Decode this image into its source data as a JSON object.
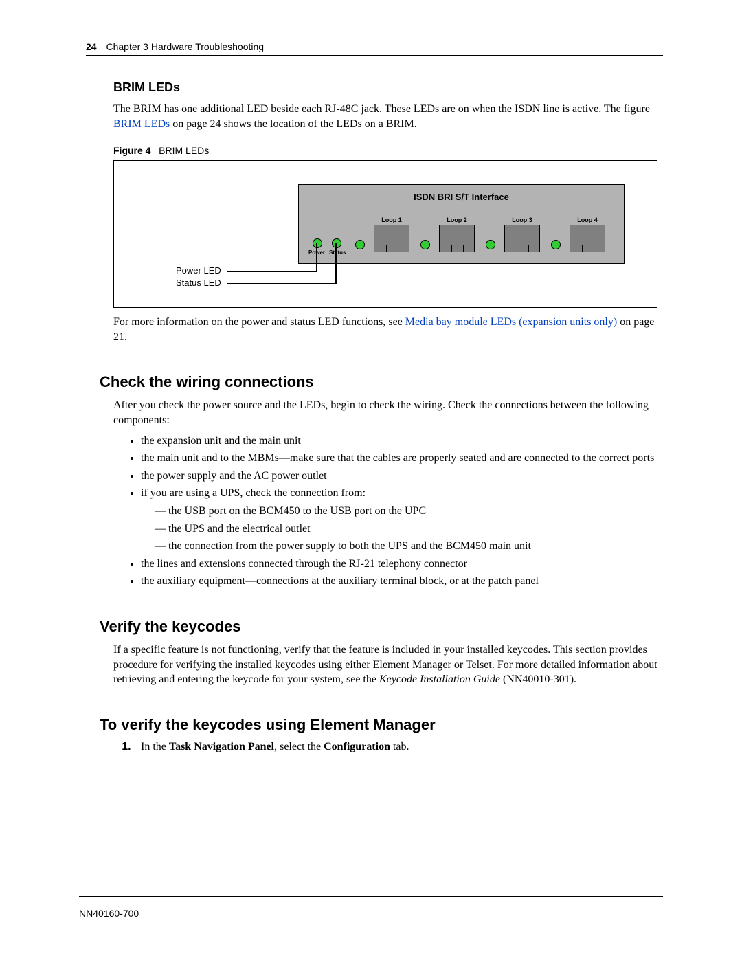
{
  "page": {
    "number": "24",
    "chapter": "Chapter 3  Hardware Troubleshooting",
    "footer_doc_id": "NN40160-700"
  },
  "sections": {
    "brim_leds": {
      "heading": "BRIM LEDs",
      "para_pre_link": "The BRIM has one additional LED beside each RJ-48C jack. These LEDs are on when the ISDN line is active. The figure ",
      "para_link_text": "BRIM LEDs",
      "para_post_link": " on page 24 shows the location of the LEDs on a BRIM.",
      "figure_label": "Figure 4",
      "figure_title": "BRIM LEDs",
      "more_info_pre": "For more information on the power and status LED functions, see ",
      "more_info_link": "Media bay module LEDs (expansion units only)",
      "more_info_post": " on page 21."
    },
    "brim_diagram": {
      "panel_title": "ISDN BRI S/T Interface",
      "loops": [
        "Loop 1",
        "Loop 2",
        "Loop 3",
        "Loop 4"
      ],
      "power_label": "Power",
      "status_label": "Status",
      "annot_power": "Power LED",
      "annot_status": "Status LED"
    },
    "check_wiring": {
      "heading": "Check the wiring connections",
      "intro": "After you check the power source and the LEDs, begin to check the wiring. Check the connections between the following components:",
      "bullets": [
        "the expansion unit and the main unit",
        "the main unit and to the MBMs—make sure that the cables are properly seated and are connected to the correct ports",
        "the power supply and the AC power outlet",
        "if you are using a UPS, check the connection from:",
        "the lines and extensions connected through the RJ-21 telephony connector",
        "the auxiliary equipment—connections at the auxiliary terminal block, or at the patch panel"
      ],
      "ups_sub": [
        "the USB port on the BCM450 to the USB port on the UPC",
        "the UPS and the electrical outlet",
        "the connection from the power supply to both the UPS and the BCM450 main unit"
      ]
    },
    "verify_keycodes": {
      "heading": "Verify the keycodes",
      "para_pre_italic": "If a specific feature is not functioning, verify that the feature is included in your installed keycodes. This section provides procedure for verifying the installed keycodes using either Element Manager or Telset. For more detailed information about retrieving and entering the keycode for your system, see the ",
      "para_italic": "Keycode Installation Guide",
      "para_post_italic": " (NN40010-301)."
    },
    "verify_em": {
      "heading": "To verify the keycodes using Element Manager",
      "step1_pre": "In the ",
      "step1_b1": "Task Navigation Panel",
      "step1_mid": ", select the ",
      "step1_b2": "Configuration",
      "step1_post": " tab."
    }
  }
}
